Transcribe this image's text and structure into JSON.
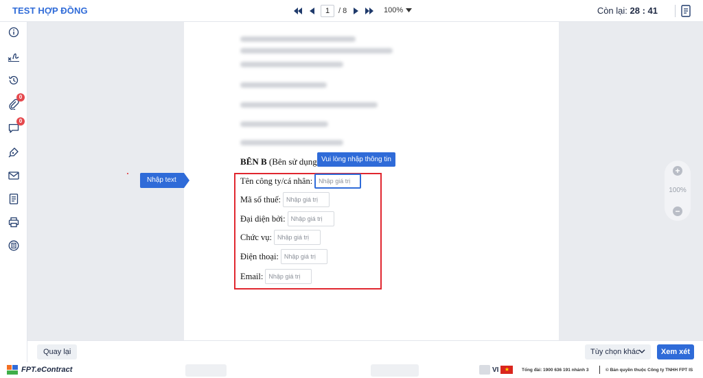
{
  "header": {
    "title": "TEST HỢP ĐỒNG",
    "current_page": "1",
    "total_pages": "/ 8",
    "zoom": "100%",
    "timer_label": "Còn lại:",
    "timer_value": "28 : 41"
  },
  "sidebar": {
    "items": [
      {
        "name": "info-icon",
        "badge": null
      },
      {
        "name": "signature-icon",
        "badge": null
      },
      {
        "name": "history-icon",
        "badge": null
      },
      {
        "name": "attachment-icon",
        "badge": "0"
      },
      {
        "name": "comment-icon",
        "badge": "0"
      },
      {
        "name": "pen-tool-icon",
        "badge": null
      },
      {
        "name": "mail-icon",
        "badge": null
      },
      {
        "name": "document-icon",
        "badge": null
      },
      {
        "name": "print-icon",
        "badge": null
      },
      {
        "name": "notes-icon",
        "badge": null
      }
    ]
  },
  "document": {
    "party_b_bold": "BÊN B",
    "party_b_rest": " (Bên sử dụng",
    "tooltip": "Vui lòng nhập thông tin",
    "field_tag": "Nhập text",
    "fields": [
      {
        "label": "Tên công ty/cá nhân:",
        "placeholder": "Nhập giá trị"
      },
      {
        "label": "Mã số thuế:",
        "placeholder": "Nhập giá trị"
      },
      {
        "label": "Đại diện bởi:",
        "placeholder": "Nhập giá trị"
      },
      {
        "label": "Chức vụ:",
        "placeholder": "Nhập giá trị"
      },
      {
        "label": "Điện thoại:",
        "placeholder": "Nhập giá trị"
      },
      {
        "label": "Email:",
        "placeholder": "Nhập giá trị"
      }
    ]
  },
  "zoom_widget": {
    "level": "100%"
  },
  "actions": {
    "back": "Quay lại",
    "more_options": "Tùy chọn khác",
    "view": "Xem xét"
  },
  "footer": {
    "logo": "FPT.eContract",
    "lang": "VI",
    "hotline": "Tổng đài: 1900 636 191 nhánh 3",
    "copyright": "© Bản quyền thuộc Công ty TNHH FPT IS"
  },
  "colors": {
    "accent": "#2f6bd8",
    "highlight_border": "#e0262e",
    "badge": "#e5484d"
  }
}
